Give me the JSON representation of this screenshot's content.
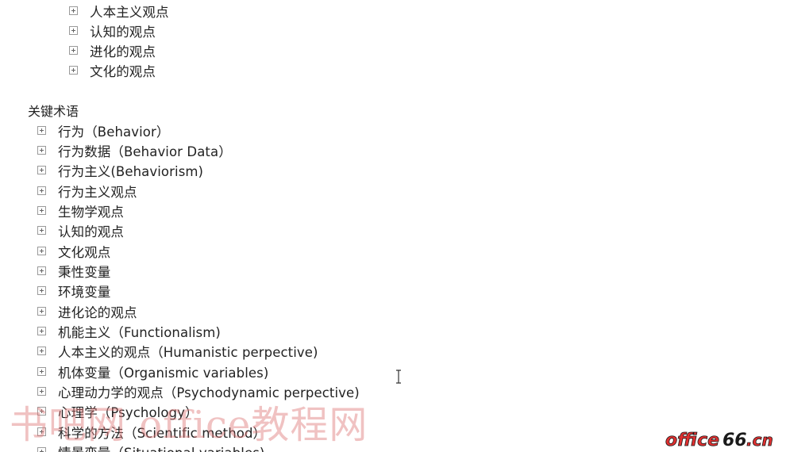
{
  "top_list": [
    {
      "label": "人本主义观点"
    },
    {
      "label": "认知的观点"
    },
    {
      "label": "进化的观点"
    },
    {
      "label": "文化的观点"
    }
  ],
  "section": {
    "title": "关键术语"
  },
  "terms": [
    {
      "label": "行为（Behavior）"
    },
    {
      "label": "行为数据（Behavior Data）"
    },
    {
      "label": "行为主义(Behaviorism)"
    },
    {
      "label": "行为主义观点"
    },
    {
      "label": "生物学观点"
    },
    {
      "label": "认知的观点"
    },
    {
      "label": "文化观点"
    },
    {
      "label": "秉性变量"
    },
    {
      "label": "环境变量"
    },
    {
      "label": "进化论的观点"
    },
    {
      "label": "机能主义（Functionalism)"
    },
    {
      "label": "人本主义的观点（Humanistic perpective)"
    },
    {
      "label": "机体变量（Organismic variables)"
    },
    {
      "label": "心理动力学的观点（Psychodynamic perpective)"
    },
    {
      "label": "心理学（Psychology）"
    },
    {
      "label": "科学的方法（Scientific method）"
    },
    {
      "label": "情景变量（Situational variables)"
    }
  ],
  "watermarks": {
    "left_text": "书吧网 office教程网",
    "right_text": "office66.cn"
  },
  "colors": {
    "text": "#222222",
    "expander_border": "#9a9a9a",
    "watermark_left": "#de7878",
    "watermark_right_red": "#e03030",
    "watermark_right_dark": "#1a1a1a"
  }
}
